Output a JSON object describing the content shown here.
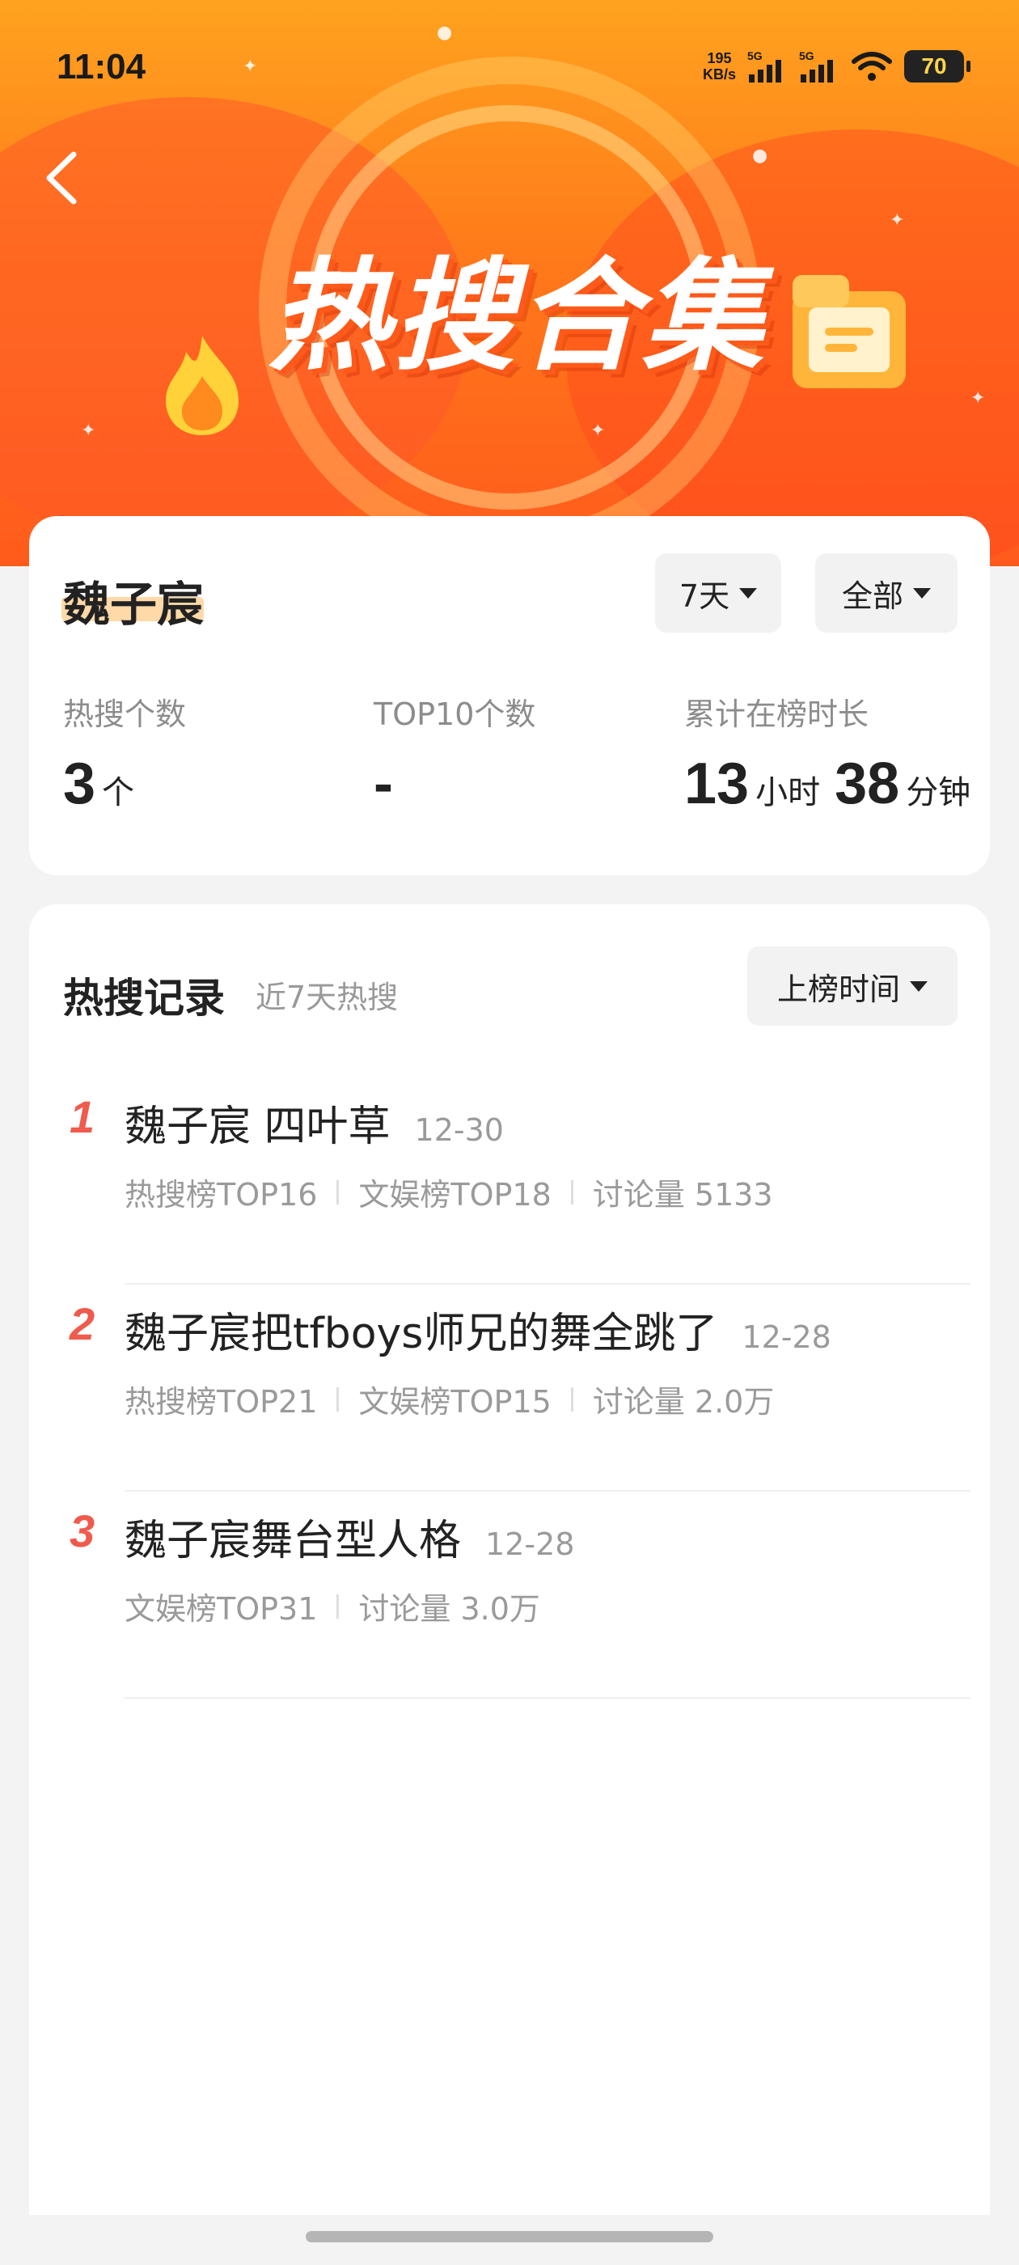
{
  "status_bar": {
    "time": "11:04",
    "net_speed_value": "195",
    "net_speed_unit": "KB/s",
    "sim1": "5G",
    "sim2": "5G",
    "battery": "70"
  },
  "banner": {
    "title": "热搜合集",
    "colors": {
      "top": "#ffa31f",
      "bottom": "#ff5a1c"
    }
  },
  "profile": {
    "name": "魏子宸",
    "filters": {
      "period": "7天",
      "scope": "全部"
    },
    "stats": [
      {
        "label": "热搜个数",
        "value": "3",
        "unit": "个"
      },
      {
        "label": "TOP10个数",
        "value": "-",
        "unit": ""
      },
      {
        "label": "累计在榜时长",
        "hours": "13",
        "hours_unit": "小时",
        "minutes": "38",
        "minutes_unit": "分钟"
      }
    ]
  },
  "records": {
    "title": "热搜记录",
    "subtitle": "近7天热搜",
    "sort_label": "上榜时间",
    "items": [
      {
        "rank": "1",
        "title": "魏子宸 四叶草",
        "date": "12-30",
        "meta": [
          "热搜榜TOP16",
          "文娱榜TOP18",
          "讨论量 5133"
        ]
      },
      {
        "rank": "2",
        "title": "魏子宸把tfboys师兄的舞全跳了",
        "date": "12-28",
        "meta": [
          "热搜榜TOP21",
          "文娱榜TOP15",
          "讨论量 2.0万"
        ]
      },
      {
        "rank": "3",
        "title": "魏子宸舞台型人格",
        "date": "12-28",
        "meta": [
          "文娱榜TOP31",
          "讨论量 3.0万"
        ]
      }
    ]
  },
  "accent_color": "#ef5b4c"
}
